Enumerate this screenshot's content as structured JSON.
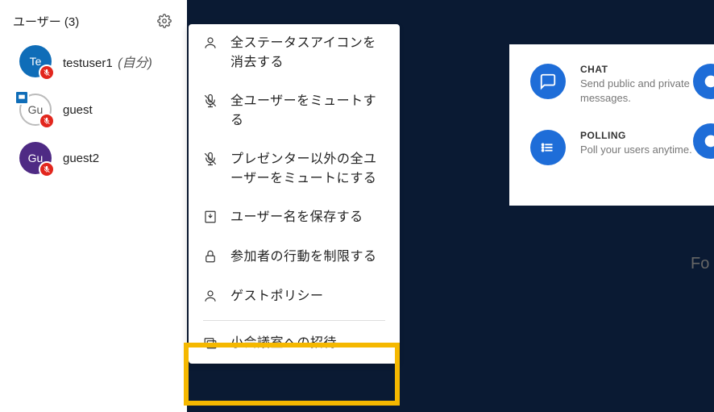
{
  "sidebar": {
    "users_header": "ユーザー (3)",
    "users": [
      {
        "initials": "Te",
        "name": "testuser1",
        "self_label": "(自分)",
        "presenter": true
      },
      {
        "initials": "Gu",
        "name": "guest",
        "presenter": true
      },
      {
        "initials": "Gu",
        "name": "guest2",
        "presenter": false
      }
    ]
  },
  "menu": {
    "items": [
      "全ステータスアイコンを消去する",
      "全ユーザーをミュートする",
      "プレゼンター以外の全ユーザーをミュートにする",
      "ユーザー名を保存する",
      "参加者の行動を制限する",
      "ゲストポリシー"
    ],
    "breakout_label": "小会議室への招待"
  },
  "promo": {
    "chat": {
      "title": "CHAT",
      "desc": "Send public and private messages."
    },
    "polling": {
      "title": "POLLING",
      "desc": "Poll your users anytime."
    }
  },
  "footer_fragment": "Fo"
}
